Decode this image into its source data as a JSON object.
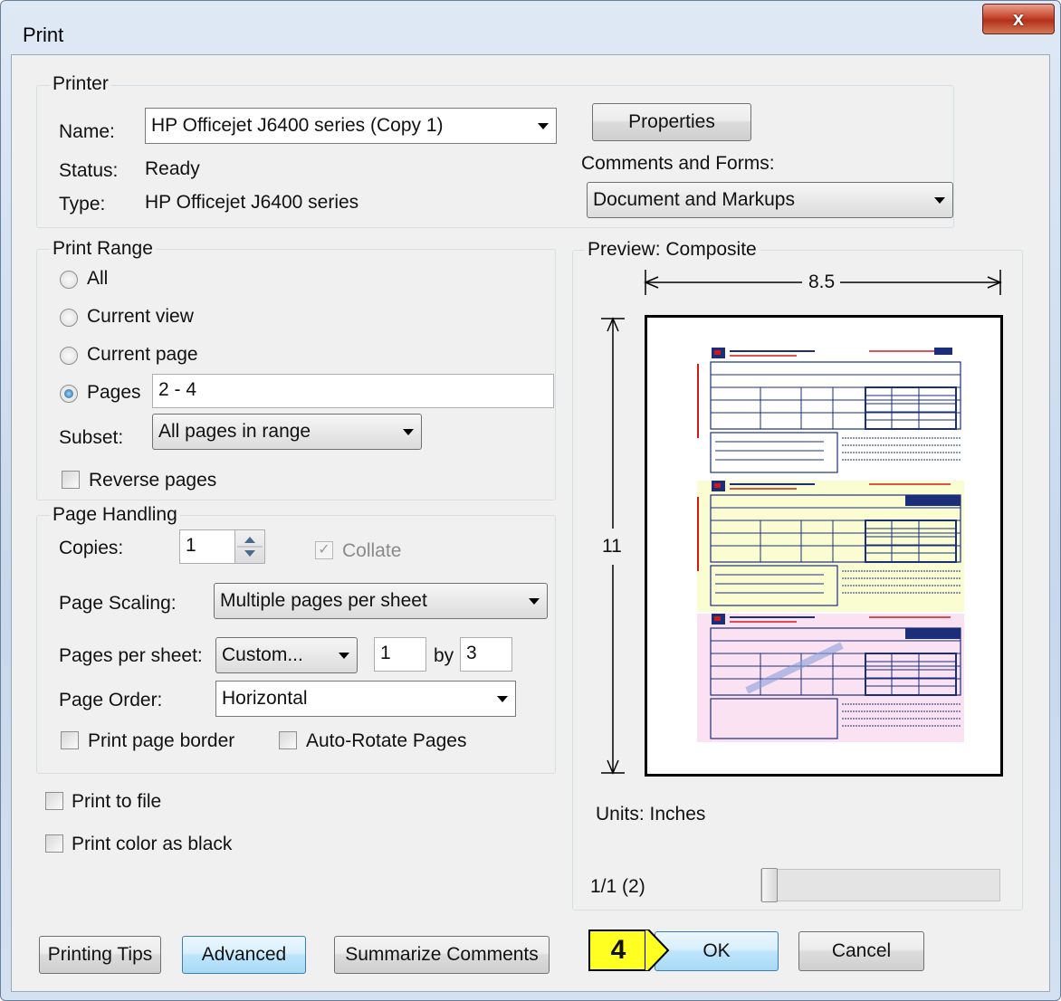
{
  "window": {
    "title": "Print",
    "close_glyph": "x"
  },
  "printer": {
    "group_label": "Printer",
    "name_label": "Name:",
    "name_value": "HP Officejet J6400 series (Copy 1)",
    "status_label": "Status:",
    "status_value": "Ready",
    "type_label": "Type:",
    "type_value": "HP Officejet J6400 series",
    "properties_button": "Properties",
    "comments_label": "Comments and Forms:",
    "comments_value": "Document and Markups"
  },
  "print_range": {
    "group_label": "Print Range",
    "all": "All",
    "current_view": "Current view",
    "current_page": "Current page",
    "pages": "Pages",
    "pages_value": "2 - 4",
    "subset_label": "Subset:",
    "subset_value": "All pages in range",
    "reverse_pages": "Reverse pages",
    "selected": "pages"
  },
  "page_handling": {
    "group_label": "Page Handling",
    "copies_label": "Copies:",
    "copies_value": "1",
    "collate": "Collate",
    "page_scaling_label": "Page Scaling:",
    "page_scaling_value": "Multiple pages per sheet",
    "pages_per_sheet_label": "Pages per sheet:",
    "pages_per_sheet_value": "Custom...",
    "per_sheet_x": "1",
    "by_label": "by",
    "per_sheet_y": "3",
    "page_order_label": "Page Order:",
    "page_order_value": "Horizontal",
    "print_page_border": "Print page border",
    "auto_rotate": "Auto-Rotate Pages"
  },
  "options": {
    "print_to_file": "Print to file",
    "print_color_as_black": "Print color as black"
  },
  "preview": {
    "group_label": "Preview: Composite",
    "width_value": "8.5",
    "height_value": "11",
    "units": "Units: Inches",
    "page_indicator": "1/1 (2)",
    "slider_position": 0
  },
  "buttons": {
    "printing_tips": "Printing Tips",
    "advanced": "Advanced",
    "summarize_comments": "Summarize Comments",
    "ok": "OK",
    "cancel": "Cancel"
  },
  "annotation": {
    "step_number": "4",
    "color": "#ffff22"
  },
  "colors": {
    "form_tint_yellow": "#fafcd2",
    "form_tint_pink": "#fbe2f2",
    "form_ink": "#1b2e7a",
    "form_red": "#d01a1a"
  }
}
